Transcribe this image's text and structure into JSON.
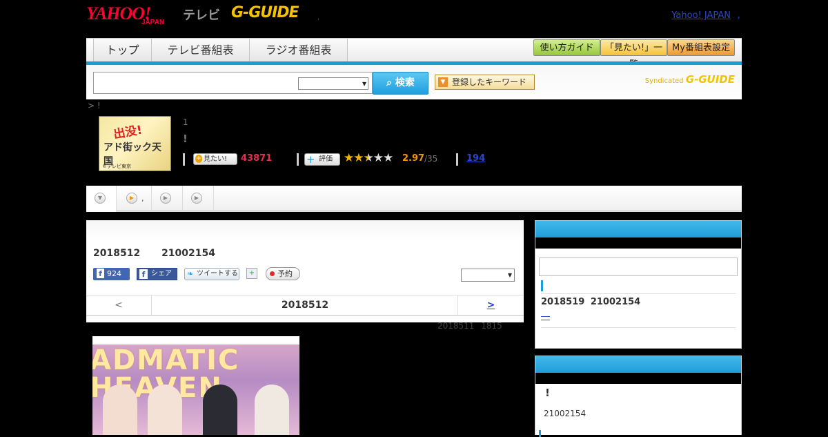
{
  "header": {
    "logo_yahoo": "YAHOO!",
    "logo_yahoo_sub": "JAPAN",
    "logo_tv": "テレビ",
    "logo_gguide": "G-GUIDE",
    "logo_dot": ",",
    "yahoo_japan_link": "Yahoo! JAPAN",
    "yahoo_japan_dot": ","
  },
  "nav": {
    "tabs": [
      {
        "label": "トップ"
      },
      {
        "label": "テレビ番組表"
      },
      {
        "label": "ラジオ番組表"
      }
    ],
    "buttons": [
      {
        "label": "使い方ガイド",
        "color": "#a7d34a"
      },
      {
        "label": "「見たい!」一覧",
        "color": "#f7c94a"
      },
      {
        "label": "My番組表設定",
        "color": "#f2a640"
      }
    ]
  },
  "search": {
    "query": "",
    "select_value": "",
    "button_label": "検索",
    "keyword_button_label": "登録したキーワード",
    "syndicated_label": "Syndicated",
    "syndicated_brand": "G-GUIDE"
  },
  "breadcrumb": "> !",
  "program": {
    "thumb_title": "出没!",
    "thumb_sub": "アド街ック天国",
    "thumb_copyright": "©テレビ東京",
    "line1": "1",
    "line2": "!",
    "mitai_label": "見たい!",
    "mitai_count": "43871",
    "eval_label": "評価",
    "rating": 2.97,
    "rating_text": "2.97",
    "rating_max_text": "/35",
    "review_count": "194"
  },
  "subtabs": [
    {
      "label": ""
    },
    {
      "label": ","
    },
    {
      "label": ""
    },
    {
      "label": ""
    }
  ],
  "main": {
    "broadcast": "2018512 21002154",
    "fb_like_count": "924",
    "fb_share_label": "シェア",
    "tweet_label": "ツイートする",
    "reserve_label": "予約",
    "select_value": "",
    "date_prev": "<",
    "date_current": "2018512",
    "date_next": ">",
    "updated": "2018511 1815"
  },
  "episode_image": {
    "text1": "ADMATIC",
    "text2": "HEAVEN"
  },
  "sidebar": {
    "box1": {
      "input_value": "",
      "date": "2018519 21002154",
      "dash": "―"
    },
    "box2": {
      "excl": "!",
      "number": "21002154"
    }
  },
  "colors": {
    "accent_blue": "#1b9bd8",
    "link_blue": "#2a46c8",
    "mitai_red": "#e62e4d",
    "score_orange": "#f29600"
  }
}
